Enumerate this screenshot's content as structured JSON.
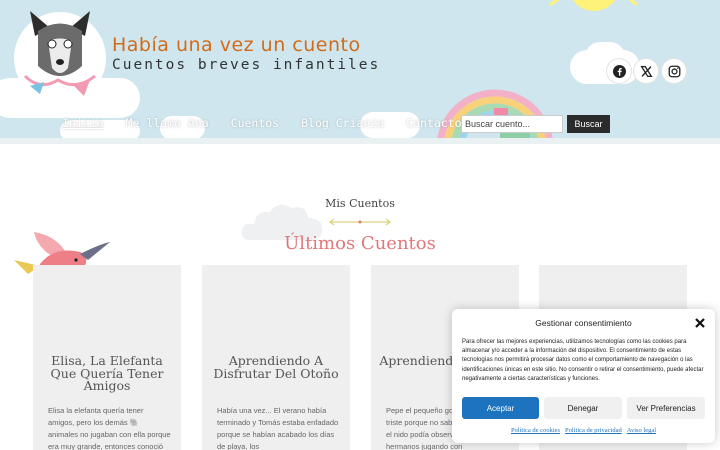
{
  "site": {
    "title": "Había una vez un cuento",
    "tagline": "Cuentos breves infantiles"
  },
  "social": [
    {
      "icon": "facebook-icon"
    },
    {
      "icon": "x-twitter-icon"
    },
    {
      "icon": "instagram-icon"
    }
  ],
  "nav": {
    "items": [
      {
        "label": "Inicio"
      },
      {
        "label": "Me llamo Ana"
      },
      {
        "label": "Cuentos"
      },
      {
        "label": "Blog Crianza"
      },
      {
        "label": "Contacto"
      }
    ]
  },
  "search": {
    "placeholder": "Buscar cuento...",
    "button_label": "Buscar"
  },
  "section": {
    "kicker": "Mis Cuentos",
    "title": "Últimos Cuentos"
  },
  "cards": [
    {
      "title": "Elisa, La Elefanta Que Quería Tener Amigos",
      "excerpt": "Elisa la elefanta quería tener amigos, pero los demás 🐘 animales no jugaban con ella porque era muy grande, entonces conoció"
    },
    {
      "title": "Aprendiendo A Disfrutar Del Otoño",
      "excerpt": "Había una vez... El verano había terminado y Tomás estaba enfadado porque se habían acabado los días de playa, los"
    },
    {
      "title": "Aprendiendo A Volar",
      "excerpt": "Pepe el pequeño gorrión estaba triste porque no sabía volar. Desde el nido podía observar a sus hermanos jugando con"
    },
    {
      "title": "",
      "excerpt": ""
    }
  ],
  "consent": {
    "title": "Gestionar consentimiento",
    "text": "Para ofrecer las mejores experiencias, utilizamos tecnologías como las cookies para almacenar y/o acceder a la información del dispositivo. El consentimiento de estas tecnologías nos permitirá procesar datos como el comportamiento de navegación o las identificaciones únicas en este sitio. No consentir o retirar el consentimiento, puede afectar negativamente a ciertas características y funciones.",
    "accept_label": "Aceptar",
    "deny_label": "Denegar",
    "prefs_label": "Ver Preferencias",
    "links": {
      "cookies": "Política de cookies",
      "privacy": "Política de privacidad",
      "legal": "Aviso legal"
    }
  },
  "colors": {
    "header_bg": "#cfe6ee",
    "title_orange": "#d26b19",
    "section_pink": "#e0787a",
    "accept_blue": "#1e73be",
    "card_bg": "#efefef"
  }
}
